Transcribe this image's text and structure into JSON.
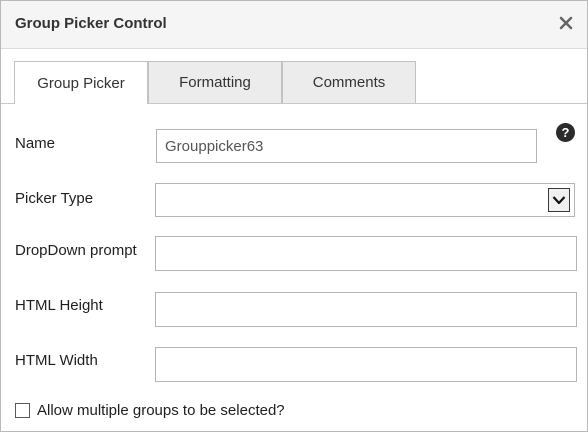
{
  "dialog": {
    "title": "Group Picker Control",
    "close_icon": "close-icon"
  },
  "tabs": [
    {
      "label": "Group Picker",
      "active": true
    },
    {
      "label": "Formatting",
      "active": false
    },
    {
      "label": "Comments",
      "active": false
    }
  ],
  "form": {
    "help_icon": "question-circle-icon",
    "help_glyph": "?",
    "name": {
      "label": "Name",
      "value": "Grouppicker63"
    },
    "picker_type": {
      "label": "Picker Type",
      "value": ""
    },
    "dropdown_prompt": {
      "label": "DropDown prompt",
      "value": ""
    },
    "html_height": {
      "label": "HTML Height",
      "value": ""
    },
    "html_width": {
      "label": "HTML Width",
      "value": ""
    },
    "allow_multiple": {
      "label": "Allow multiple groups to be selected?",
      "checked": false
    }
  }
}
